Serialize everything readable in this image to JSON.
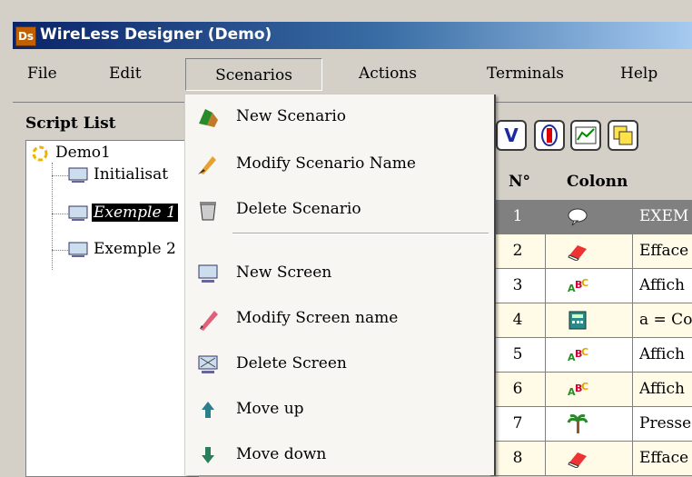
{
  "window": {
    "title": "WireLess Designer (Demo)",
    "icon": "app-icon",
    "icon_letters": "Ds"
  },
  "menubar": {
    "items": [
      {
        "label": "File"
      },
      {
        "label": "Edit"
      },
      {
        "label": "Scenarios"
      },
      {
        "label": "Actions"
      },
      {
        "label": "Terminals"
      },
      {
        "label": "Help"
      }
    ]
  },
  "script_list": {
    "title": "Script List",
    "root": "Demo1",
    "items": [
      "Initialisat",
      "Exemple 1",
      "Exemple 2"
    ],
    "selected_index": 1
  },
  "toolbar": {
    "buttons": [
      "v-icon",
      "shield-icon",
      "chart-icon",
      "window-icon"
    ]
  },
  "grid": {
    "headers": [
      "N°",
      "Colonn"
    ],
    "rows": [
      {
        "n": "1",
        "icon": "speech-bubble-icon",
        "text": "EXEM"
      },
      {
        "n": "2",
        "icon": "eraser-icon",
        "text": "Efface"
      },
      {
        "n": "3",
        "icon": "abc-icon",
        "text": "Affich"
      },
      {
        "n": "4",
        "icon": "calculator-icon",
        "text": "a = Co"
      },
      {
        "n": "5",
        "icon": "abc-icon",
        "text": "Affich"
      },
      {
        "n": "6",
        "icon": "abc-icon",
        "text": "Affich"
      },
      {
        "n": "7",
        "icon": "palm-tree-icon",
        "text": "Presse"
      },
      {
        "n": "8",
        "icon": "eraser-icon",
        "text": "Efface"
      }
    ]
  },
  "dropdown": {
    "items": [
      {
        "label": "New Scenario",
        "icon": "new-scenario-icon"
      },
      {
        "label": "Modify Scenario Name",
        "icon": "modify-scenario-icon"
      },
      {
        "label": "Delete Scenario",
        "icon": "trash-icon"
      },
      {
        "label": "New Screen",
        "icon": "new-screen-icon"
      },
      {
        "label": "Modify Screen name",
        "icon": "pencil-icon"
      },
      {
        "label": "Delete Screen",
        "icon": "delete-screen-icon"
      },
      {
        "label": "Move up",
        "icon": "arrow-up-icon"
      },
      {
        "label": "Move down",
        "icon": "arrow-down-icon"
      }
    ]
  },
  "colors": {
    "title_grad_start": "#0a246a",
    "title_grad_end": "#a6caf0",
    "selected_row_bg": "#808080",
    "row_alt_bg": "#fffbe6"
  }
}
